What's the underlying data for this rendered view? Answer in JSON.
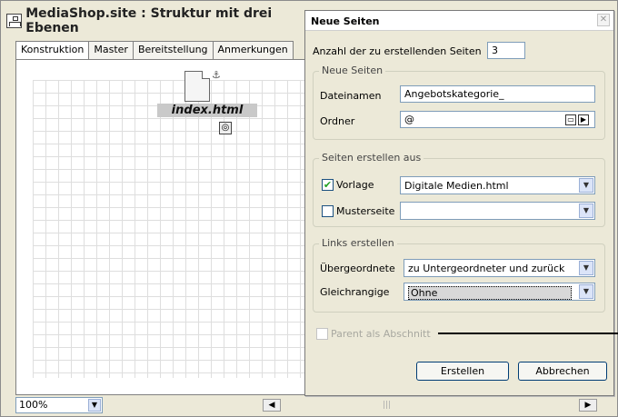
{
  "window": {
    "title": "MediaShop.site : Struktur mit drei Ebenen",
    "tabs": [
      "Konstruktion",
      "Master",
      "Bereitstellung",
      "Anmerkungen"
    ],
    "page_node_label": "index.html",
    "zoom": "100%"
  },
  "dialog": {
    "title": "Neue Seiten",
    "close_glyph": "✕",
    "count_label": "Anzahl der zu erstellenden Seiten",
    "count_value": "3",
    "group_new_pages": {
      "legend": "Neue Seiten",
      "filename_label": "Dateinamen",
      "filename_value": "Angebotskategorie_",
      "folder_label": "Ordner",
      "folder_value": "@"
    },
    "group_create_from": {
      "legend": "Seiten erstellen aus",
      "template_label": "Vorlage",
      "template_checked": true,
      "template_value": "Digitale Medien.html",
      "master_label": "Musterseite",
      "master_checked": false,
      "master_value": ""
    },
    "group_links": {
      "legend": "Links erstellen",
      "parent_label": "Übergeordnete",
      "parent_value": "zu Untergeordneter und zurück",
      "sibling_label": "Gleichrangige",
      "sibling_value": "Ohne"
    },
    "parent_section_label": "Parent als Abschnitt",
    "parent_section_checked": false,
    "create_button": "Erstellen",
    "cancel_button": "Abbrechen"
  }
}
